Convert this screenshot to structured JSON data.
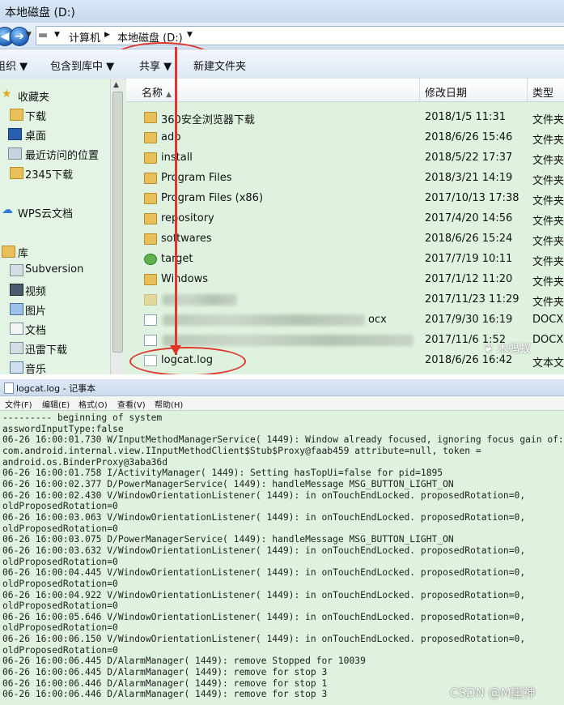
{
  "explorer": {
    "title": "本地磁盘 (D:)",
    "breadcrumb": [
      "计算机",
      "本地磁盘 (D:)"
    ],
    "toolbar": [
      "组织",
      "包含到库中",
      "共享",
      "新建文件夹"
    ],
    "nav_items": [
      {
        "label": "收藏夹",
        "icon": "star-icon"
      },
      {
        "label": "下载",
        "icon": "folder-icon"
      },
      {
        "label": "桌面",
        "icon": "desktop-icon"
      },
      {
        "label": "最近访问的位置",
        "icon": "recent-places-icon"
      },
      {
        "label": "2345下载",
        "icon": "folder-icon"
      },
      {
        "label": "WPS云文档",
        "icon": "cloud-icon"
      },
      {
        "label": "库",
        "icon": "library-icon"
      },
      {
        "label": "Subversion",
        "icon": "library-icon"
      },
      {
        "label": "视频",
        "icon": "video-icon"
      },
      {
        "label": "图片",
        "icon": "picture-icon"
      },
      {
        "label": "文档",
        "icon": "document-icon"
      },
      {
        "label": "迅雷下载",
        "icon": "download-icon"
      },
      {
        "label": "音乐",
        "icon": "music-icon"
      }
    ],
    "columns": {
      "name": "名称",
      "date": "修改日期",
      "type": "类型"
    },
    "files": [
      {
        "name": "360安全浏览器下载",
        "date": "2018/1/5 11:31",
        "type": "文件夹",
        "icon": "folder-icon"
      },
      {
        "name": "adb",
        "date": "2018/6/26 15:46",
        "type": "文件夹",
        "icon": "folder-icon"
      },
      {
        "name": "install",
        "date": "2018/5/22 17:37",
        "type": "文件夹",
        "icon": "folder-icon"
      },
      {
        "name": "Program Files",
        "date": "2018/3/21 14:19",
        "type": "文件夹",
        "icon": "folder-icon"
      },
      {
        "name": "Program Files (x86)",
        "date": "2017/10/13 17:38",
        "type": "文件夹",
        "icon": "folder-icon"
      },
      {
        "name": "repository",
        "date": "2017/4/20 14:56",
        "type": "文件夹",
        "icon": "folder-icon"
      },
      {
        "name": "softwares",
        "date": "2018/6/26 15:24",
        "type": "文件夹",
        "icon": "folder-icon"
      },
      {
        "name": "target",
        "date": "2017/7/19 10:11",
        "type": "文件夹",
        "icon": "folder-icon"
      },
      {
        "name": "Windows",
        "date": "2017/1/12 11:20",
        "type": "文件夹",
        "icon": "folder-icon"
      },
      {
        "name": "",
        "date": "2017/11/23 11:29",
        "type": "文件夹",
        "icon": "folder-icon"
      },
      {
        "name": "ocx",
        "date": "2017/9/30 16:19",
        "type": "DOCX",
        "icon": "document-icon"
      },
      {
        "name": "",
        "date": "2017/11/6 1:52",
        "type": "DOCX",
        "icon": "document-icon"
      },
      {
        "name": "logcat.log",
        "date": "2018/6/26 16:42",
        "type": "文本文",
        "icon": "text-file-icon"
      }
    ],
    "watermark": "木蚂蚁"
  },
  "notepad": {
    "title": "logcat.log - 记事本",
    "menu": [
      "文件(F)",
      "编辑(E)",
      "格式(O)",
      "查看(V)",
      "帮助(H)"
    ],
    "lines": [
      "--------- beginning of system",
      "asswordInputType:false",
      "06-26 16:00:01.730 W/InputMethodManagerService( 1449): Window already focused, ignoring focus gain of:",
      "com.android.internal.view.IInputMethodClient$Stub$Proxy@faab459 attribute=null, token =",
      "android.os.BinderProxy@3aba36d",
      "06-26 16:00:01.758 I/ActivityManager( 1449): Setting hasTopUi=false for pid=1895",
      "06-26 16:00:02.377 D/PowerManagerService( 1449): handleMessage MSG_BUTTON_LIGHT_ON",
      "06-26 16:00:02.430 V/WindowOrientationListener( 1449): in onTouchEndLocked. proposedRotation=0,",
      "oldProposedRotation=0",
      "06-26 16:00:03.063 V/WindowOrientationListener( 1449): in onTouchEndLocked. proposedRotation=0,",
      "oldProposedRotation=0",
      "06-26 16:00:03.075 D/PowerManagerService( 1449): handleMessage MSG_BUTTON_LIGHT_ON",
      "06-26 16:00:03.632 V/WindowOrientationListener( 1449): in onTouchEndLocked. proposedRotation=0,",
      "oldProposedRotation=0",
      "06-26 16:00:04.445 V/WindowOrientationListener( 1449): in onTouchEndLocked. proposedRotation=0,",
      "oldProposedRotation=0",
      "06-26 16:00:04.922 V/WindowOrientationListener( 1449): in onTouchEndLocked. proposedRotation=0,",
      "oldProposedRotation=0",
      "06-26 16:00:05.646 V/WindowOrientationListener( 1449): in onTouchEndLocked. proposedRotation=0,",
      "oldProposedRotation=0",
      "06-26 16:00:06.150 V/WindowOrientationListener( 1449): in onTouchEndLocked. proposedRotation=0,",
      "oldProposedRotation=0",
      "06-26 16:00:06.445 D/AlarmManager( 1449): remove Stopped for 10039",
      "06-26 16:00:06.445 D/AlarmManager( 1449): remove for stop 3",
      "06-26 16:00:06.446 D/AlarmManager( 1449): remove for stop 1",
      "06-26 16:00:06.446 D/AlarmManager( 1449): remove for stop 3"
    ],
    "credit": "CSDN @M崖神"
  },
  "colors": {
    "highlight": "#e0362c",
    "pane_bg": "#dff2df"
  }
}
